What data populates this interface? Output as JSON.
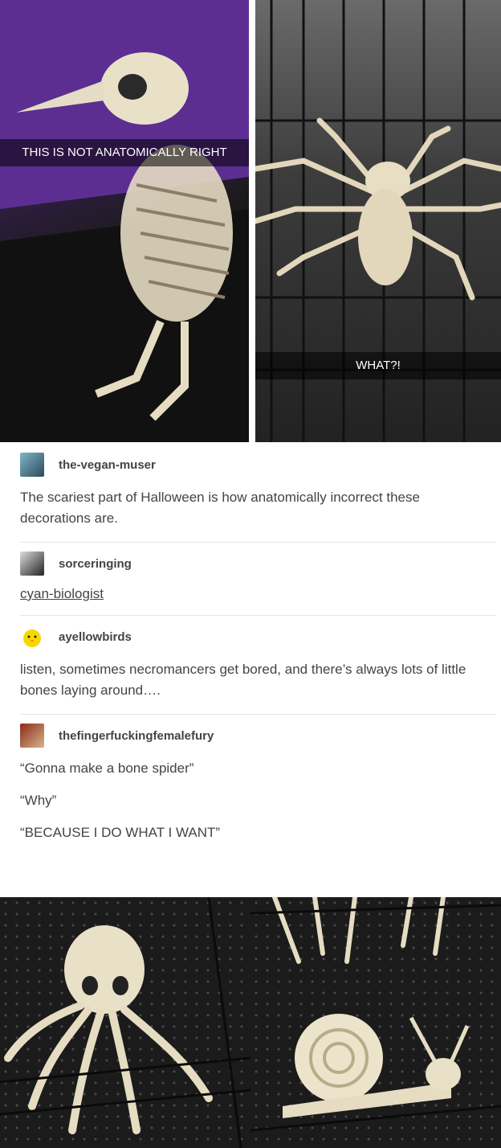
{
  "top_images": {
    "left_caption": "THIS IS NOT ANATOMICALLY RIGHT",
    "right_caption": "WHAT?!"
  },
  "posts": [
    {
      "username": "the-vegan-muser",
      "text": "The scariest part of Halloween is how anatomically incorrect these decorations are."
    },
    {
      "username": "sorceringing",
      "link": "cyan-biologist"
    },
    {
      "username": "ayellowbirds",
      "text": "listen, sometimes necromancers get bored, and there’s always lots of little bones laying around…."
    },
    {
      "username": "thefingerfuckingfemalefury",
      "lines": [
        "“Gonna make a bone spider”",
        "“Why”",
        "“BECAUSE I DO WHAT I WANT”"
      ]
    }
  ]
}
